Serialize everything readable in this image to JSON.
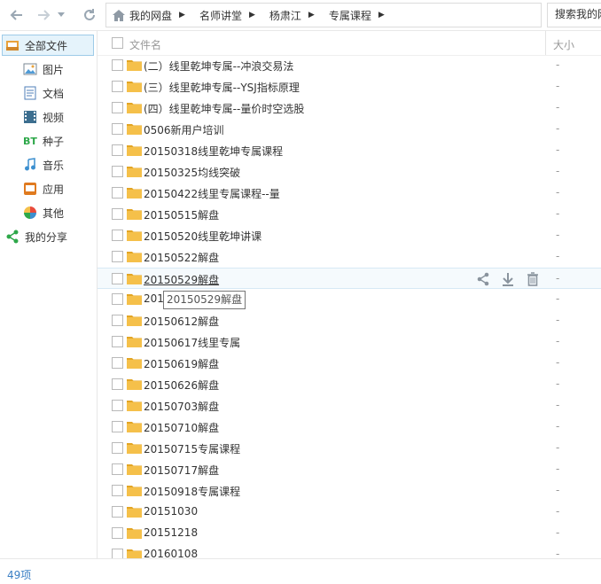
{
  "toolbar": {
    "breadcrumb": [
      "我的网盘",
      "名师讲堂",
      "杨肃江",
      "专属课程"
    ],
    "search_placeholder": "搜索我的网"
  },
  "sidebar": {
    "items": [
      {
        "label": "全部文件",
        "icon": "all-files-icon"
      },
      {
        "label": "图片",
        "icon": "picture-icon"
      },
      {
        "label": "文档",
        "icon": "document-icon"
      },
      {
        "label": "视频",
        "icon": "video-icon"
      },
      {
        "label": "种子",
        "icon": "bt-icon"
      },
      {
        "label": "音乐",
        "icon": "music-icon"
      },
      {
        "label": "应用",
        "icon": "app-icon"
      },
      {
        "label": "其他",
        "icon": "other-icon"
      },
      {
        "label": "我的分享",
        "icon": "share-icon"
      }
    ]
  },
  "header": {
    "name": "文件名",
    "size": "大小"
  },
  "files": [
    {
      "name": "(二）线里乾坤专属--冲浪交易法",
      "size": "-"
    },
    {
      "name": "(三）线里乾坤专属--YSJ指标原理",
      "size": "-"
    },
    {
      "name": "(四）线里乾坤专属--量价时空选股",
      "size": "-"
    },
    {
      "name": "0506新用户培训",
      "size": "-"
    },
    {
      "name": "20150318线里乾坤专属课程",
      "size": "-"
    },
    {
      "name": "20150325均线突破",
      "size": "-"
    },
    {
      "name": "20150422线里专属课程--量",
      "size": "-"
    },
    {
      "name": "20150515解盘",
      "size": "-"
    },
    {
      "name": "20150520线里乾坤讲课",
      "size": "-"
    },
    {
      "name": "20150522解盘",
      "size": "-"
    },
    {
      "name": "20150529解盘",
      "size": "-"
    },
    {
      "name": "201",
      "size": "-"
    },
    {
      "name": "20150612解盘",
      "size": "-"
    },
    {
      "name": "20150617线里专属",
      "size": "-"
    },
    {
      "name": "20150619解盘",
      "size": "-"
    },
    {
      "name": "20150626解盘",
      "size": "-"
    },
    {
      "name": "20150703解盘",
      "size": "-"
    },
    {
      "name": "20150710解盘",
      "size": "-"
    },
    {
      "name": "20150715专属课程",
      "size": "-"
    },
    {
      "name": "20150717解盘",
      "size": "-"
    },
    {
      "name": "20150918专属课程",
      "size": "-"
    },
    {
      "name": "20151030",
      "size": "-"
    },
    {
      "name": "20151218",
      "size": "-"
    },
    {
      "name": "20160108",
      "size": "-"
    }
  ],
  "hovered_row": 10,
  "tooltip": "20150529解盘",
  "status": {
    "count": "49项"
  },
  "colors": {
    "accent": "#3a7fc4",
    "folder": "#f5c04a",
    "selected_bg": "#e5f3fb"
  }
}
